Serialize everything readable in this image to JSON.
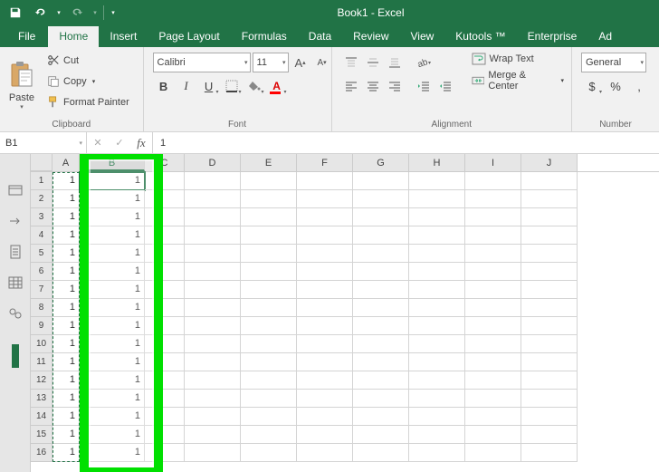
{
  "title": "Book1 - Excel",
  "qat": {
    "save": "save-icon",
    "undo": "undo-icon",
    "redo": "redo-icon"
  },
  "tabs": {
    "items": [
      {
        "label": "File"
      },
      {
        "label": "Home"
      },
      {
        "label": "Insert"
      },
      {
        "label": "Page Layout"
      },
      {
        "label": "Formulas"
      },
      {
        "label": "Data"
      },
      {
        "label": "Review"
      },
      {
        "label": "View"
      },
      {
        "label": "Kutools ™"
      },
      {
        "label": "Enterprise"
      },
      {
        "label": "Ad"
      }
    ],
    "active_index": 1
  },
  "ribbon": {
    "clipboard": {
      "paste": "Paste",
      "cut": "Cut",
      "copy": "Copy",
      "format_painter": "Format Painter",
      "group_label": "Clipboard"
    },
    "font": {
      "name": "Calibri",
      "size": "11",
      "increase": "A",
      "decrease": "A",
      "bold": "B",
      "italic": "I",
      "underline": "U",
      "group_label": "Font",
      "fill_color": "#ffff00",
      "font_color": "#ff0000"
    },
    "alignment": {
      "wrap_text": "Wrap Text",
      "merge_center": "Merge & Center",
      "group_label": "Alignment"
    },
    "number": {
      "format": "General",
      "group_label": "Number",
      "currency": "$",
      "percent": "%",
      "comma": ","
    }
  },
  "formula_bar": {
    "name_box": "B1",
    "cancel": "✕",
    "enter": "✓",
    "fx": "fx",
    "value": "1"
  },
  "sheet": {
    "columns": [
      "A",
      "B",
      "C",
      "D",
      "E",
      "F",
      "G",
      "H",
      "I",
      "J"
    ],
    "selected_column_index": 1,
    "active_cell": {
      "row": 0,
      "col": 1
    },
    "row_count": 16,
    "data": {
      "A": [
        "1",
        "1",
        "1",
        "1",
        "1",
        "1",
        "1",
        "1",
        "1",
        "1",
        "1",
        "1",
        "1",
        "1",
        "1",
        "1"
      ],
      "B": [
        "1",
        "1",
        "1",
        "1",
        "1",
        "1",
        "1",
        "1",
        "1",
        "1",
        "1",
        "1",
        "1",
        "1",
        "1",
        "1"
      ]
    }
  },
  "left_panel_icons": [
    "panel-icon-1",
    "panel-icon-2",
    "panel-icon-3",
    "panel-icon-4",
    "panel-icon-5",
    "panel-icon-6"
  ]
}
